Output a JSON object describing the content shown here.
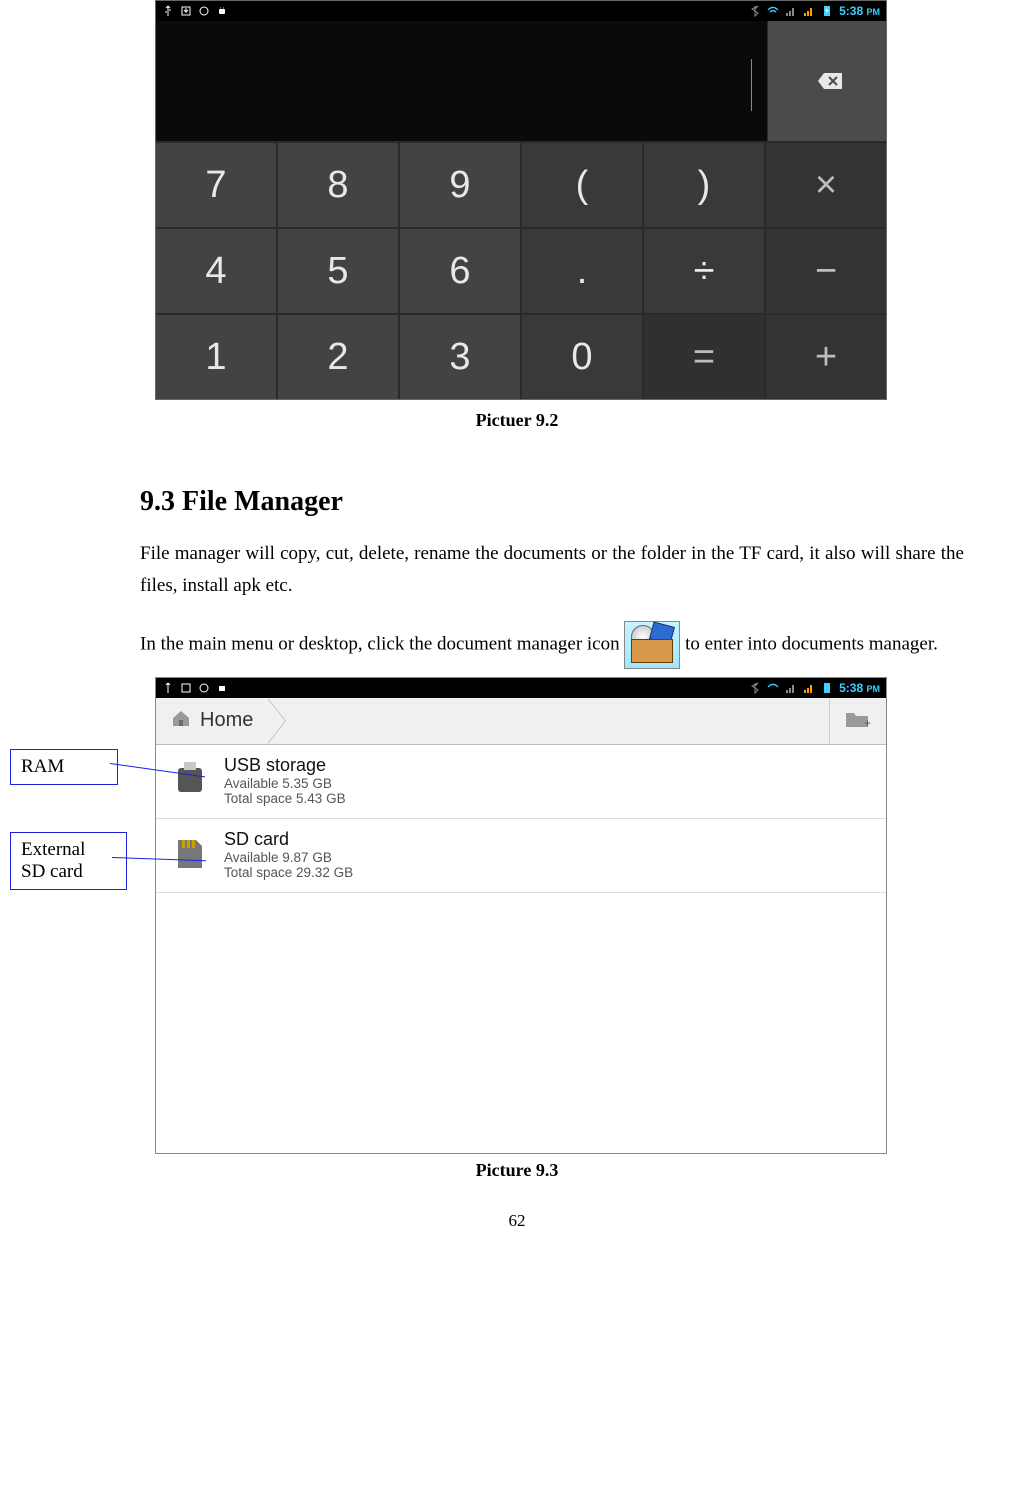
{
  "status_bar": {
    "time": "5:38",
    "time_suffix": "PM"
  },
  "calculator": {
    "keys": [
      {
        "label": "7",
        "cls": "num"
      },
      {
        "label": "8",
        "cls": "num"
      },
      {
        "label": "9",
        "cls": "num"
      },
      {
        "label": "(",
        "cls": "op0"
      },
      {
        "label": ")",
        "cls": "op0"
      },
      {
        "label": "×",
        "cls": "op1"
      },
      {
        "label": "4",
        "cls": "num"
      },
      {
        "label": "5",
        "cls": "num"
      },
      {
        "label": "6",
        "cls": "num"
      },
      {
        "label": ".",
        "cls": "op0"
      },
      {
        "label": "÷",
        "cls": "op0"
      },
      {
        "label": "−",
        "cls": "op1"
      },
      {
        "label": "1",
        "cls": "num"
      },
      {
        "label": "2",
        "cls": "num"
      },
      {
        "label": "3",
        "cls": "num"
      },
      {
        "label": "0",
        "cls": "op0"
      },
      {
        "label": "=",
        "cls": "eq"
      },
      {
        "label": "+",
        "cls": "op1"
      }
    ]
  },
  "captions": {
    "calc": "Pictuer 9.2",
    "fm": "Picture 9.3"
  },
  "section_heading": "9.3 File Manager",
  "para1": "File manager will copy, cut, delete, rename the documents or the folder in the TF card, it also will share the files, install apk etc.",
  "para2_a": "In the main menu or desktop, click the document manager icon ",
  "para2_b": " to enter into documents manager.",
  "filemanager": {
    "breadcrumb": "Home",
    "items": [
      {
        "title": "USB storage",
        "line1": "Available 5.35 GB",
        "line2": "Total space 5.43 GB",
        "icon": "usb"
      },
      {
        "title": "SD card",
        "line1": "Available 9.87 GB",
        "line2": "Total space 29.32 GB",
        "icon": "sd"
      }
    ]
  },
  "callouts": {
    "ram": "RAM",
    "sd": "External\nSD card"
  },
  "page_number": "62"
}
